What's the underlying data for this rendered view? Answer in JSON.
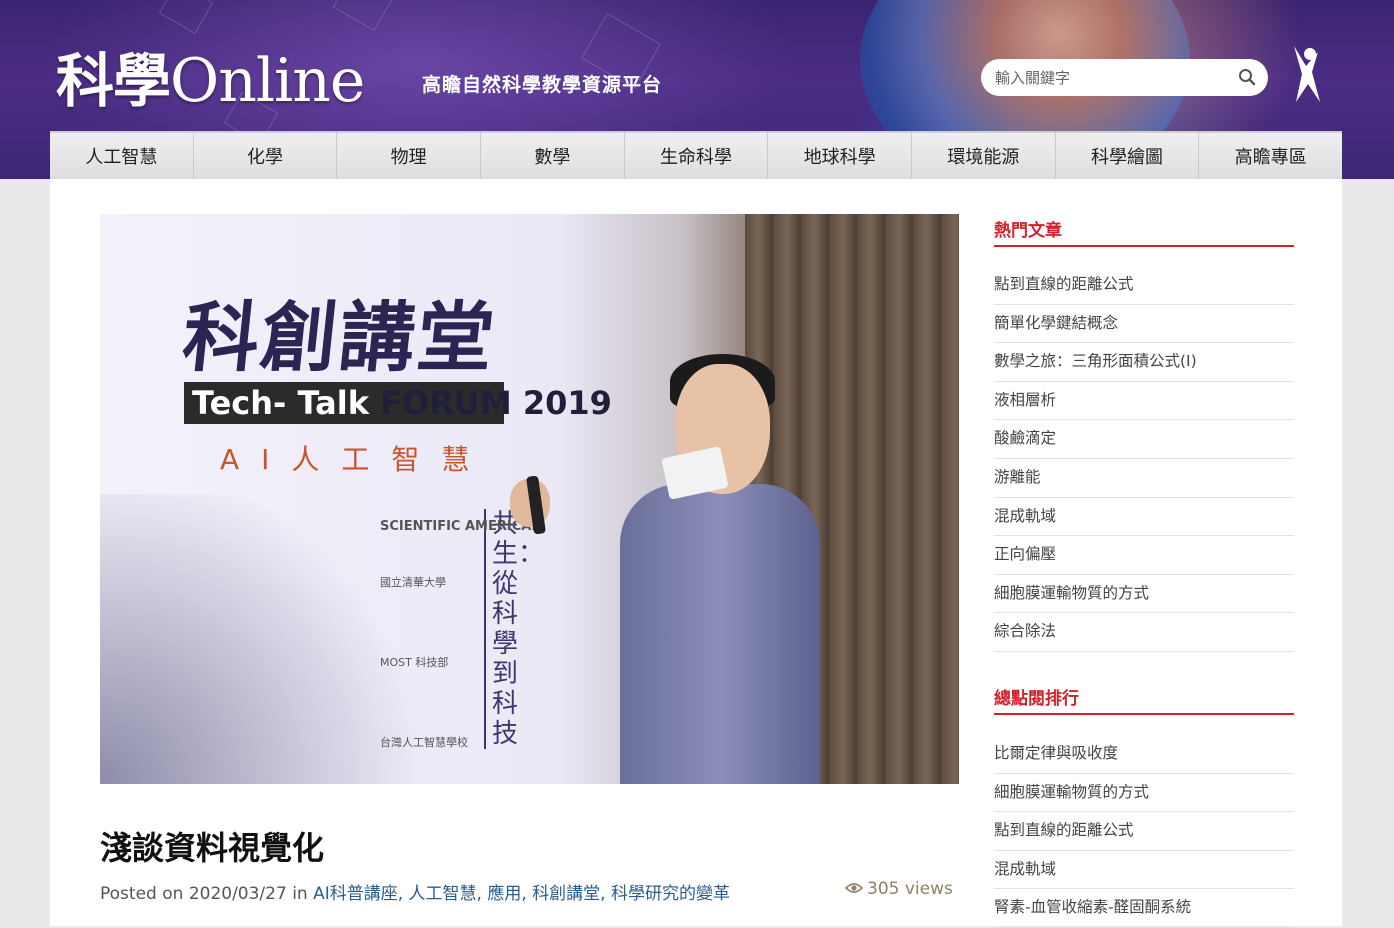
{
  "header": {
    "logo_main": "科學",
    "logo_online": "Online",
    "tagline": "高瞻自然科學教學資源平台",
    "search_placeholder": "輸入關鍵字"
  },
  "nav": {
    "items": [
      "人工智慧",
      "化學",
      "物理",
      "數學",
      "生命科學",
      "地球科學",
      "環境能源",
      "科學繪圖",
      "高瞻專區"
    ]
  },
  "hero": {
    "poster_title": "科創講堂",
    "poster_forum_a": "Tech- Talk",
    "poster_forum_b": "FORUM 2019",
    "poster_ai": "AI人工智慧",
    "poster_vertical": "共生：從科學到科技",
    "sponsor_1": "SCIENTIFIC AMERICAN",
    "sponsor_2": "國立清華大學",
    "sponsor_3": "MOST 科技部",
    "sponsor_4": "台灣人工智慧學校"
  },
  "post": {
    "title": "淺談資料視覺化",
    "posted_on_label": "Posted on",
    "date": "2020/03/27",
    "in_label": "in",
    "categories": "AI科普講座, 人工智慧, 應用, 科創講堂, 科學研究的變革",
    "views": "305 views"
  },
  "sidebar": {
    "popular_title": "熱門文章",
    "popular": [
      "點到直線的距離公式",
      "簡單化學鍵結概念",
      "數學之旅：三角形面積公式(I)",
      "液相層析",
      "酸鹼滴定",
      "游離能",
      "混成軌域",
      "正向偏壓",
      "細胞膜運輸物質的方式",
      "綜合除法"
    ],
    "ranking_title": "總點閱排行",
    "ranking": [
      "比爾定律與吸收度",
      "細胞膜運輸物質的方式",
      "點到直線的距離公式",
      "混成軌域",
      "腎素-血管收縮素-醛固酮系統"
    ]
  },
  "colors": {
    "accent_red": "#d3222a",
    "banner_purple": "#4b2d85",
    "link_blue": "#2b5d8c"
  }
}
